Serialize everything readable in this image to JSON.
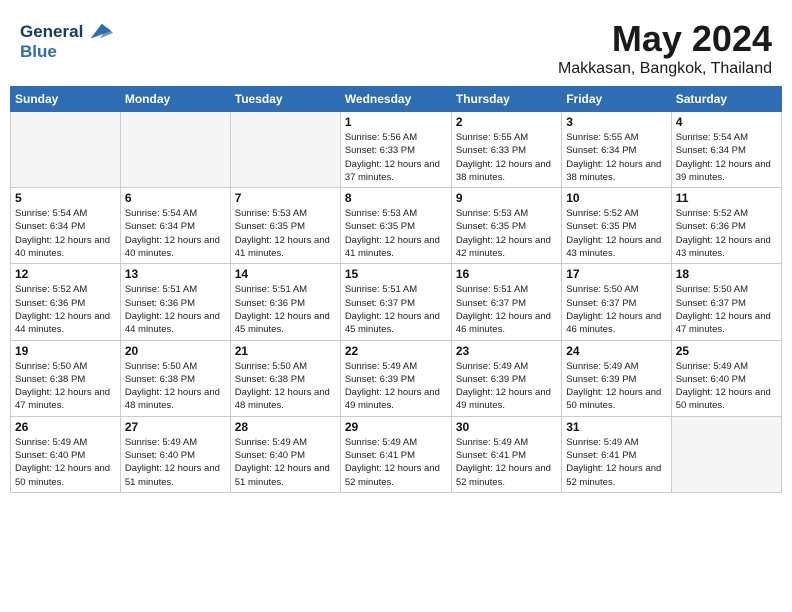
{
  "header": {
    "logo_line1": "General",
    "logo_line2": "Blue",
    "month": "May 2024",
    "location": "Makkasan, Bangkok, Thailand"
  },
  "days_of_week": [
    "Sunday",
    "Monday",
    "Tuesday",
    "Wednesday",
    "Thursday",
    "Friday",
    "Saturday"
  ],
  "weeks": [
    [
      {
        "day": "",
        "sunrise": "",
        "sunset": "",
        "daylight": "",
        "empty": true
      },
      {
        "day": "",
        "sunrise": "",
        "sunset": "",
        "daylight": "",
        "empty": true
      },
      {
        "day": "",
        "sunrise": "",
        "sunset": "",
        "daylight": "",
        "empty": true
      },
      {
        "day": "1",
        "sunrise": "Sunrise: 5:56 AM",
        "sunset": "Sunset: 6:33 PM",
        "daylight": "Daylight: 12 hours and 37 minutes.",
        "empty": false
      },
      {
        "day": "2",
        "sunrise": "Sunrise: 5:55 AM",
        "sunset": "Sunset: 6:33 PM",
        "daylight": "Daylight: 12 hours and 38 minutes.",
        "empty": false
      },
      {
        "day": "3",
        "sunrise": "Sunrise: 5:55 AM",
        "sunset": "Sunset: 6:34 PM",
        "daylight": "Daylight: 12 hours and 38 minutes.",
        "empty": false
      },
      {
        "day": "4",
        "sunrise": "Sunrise: 5:54 AM",
        "sunset": "Sunset: 6:34 PM",
        "daylight": "Daylight: 12 hours and 39 minutes.",
        "empty": false
      }
    ],
    [
      {
        "day": "5",
        "sunrise": "Sunrise: 5:54 AM",
        "sunset": "Sunset: 6:34 PM",
        "daylight": "Daylight: 12 hours and 40 minutes.",
        "empty": false
      },
      {
        "day": "6",
        "sunrise": "Sunrise: 5:54 AM",
        "sunset": "Sunset: 6:34 PM",
        "daylight": "Daylight: 12 hours and 40 minutes.",
        "empty": false
      },
      {
        "day": "7",
        "sunrise": "Sunrise: 5:53 AM",
        "sunset": "Sunset: 6:35 PM",
        "daylight": "Daylight: 12 hours and 41 minutes.",
        "empty": false
      },
      {
        "day": "8",
        "sunrise": "Sunrise: 5:53 AM",
        "sunset": "Sunset: 6:35 PM",
        "daylight": "Daylight: 12 hours and 41 minutes.",
        "empty": false
      },
      {
        "day": "9",
        "sunrise": "Sunrise: 5:53 AM",
        "sunset": "Sunset: 6:35 PM",
        "daylight": "Daylight: 12 hours and 42 minutes.",
        "empty": false
      },
      {
        "day": "10",
        "sunrise": "Sunrise: 5:52 AM",
        "sunset": "Sunset: 6:35 PM",
        "daylight": "Daylight: 12 hours and 43 minutes.",
        "empty": false
      },
      {
        "day": "11",
        "sunrise": "Sunrise: 5:52 AM",
        "sunset": "Sunset: 6:36 PM",
        "daylight": "Daylight: 12 hours and 43 minutes.",
        "empty": false
      }
    ],
    [
      {
        "day": "12",
        "sunrise": "Sunrise: 5:52 AM",
        "sunset": "Sunset: 6:36 PM",
        "daylight": "Daylight: 12 hours and 44 minutes.",
        "empty": false
      },
      {
        "day": "13",
        "sunrise": "Sunrise: 5:51 AM",
        "sunset": "Sunset: 6:36 PM",
        "daylight": "Daylight: 12 hours and 44 minutes.",
        "empty": false
      },
      {
        "day": "14",
        "sunrise": "Sunrise: 5:51 AM",
        "sunset": "Sunset: 6:36 PM",
        "daylight": "Daylight: 12 hours and 45 minutes.",
        "empty": false
      },
      {
        "day": "15",
        "sunrise": "Sunrise: 5:51 AM",
        "sunset": "Sunset: 6:37 PM",
        "daylight": "Daylight: 12 hours and 45 minutes.",
        "empty": false
      },
      {
        "day": "16",
        "sunrise": "Sunrise: 5:51 AM",
        "sunset": "Sunset: 6:37 PM",
        "daylight": "Daylight: 12 hours and 46 minutes.",
        "empty": false
      },
      {
        "day": "17",
        "sunrise": "Sunrise: 5:50 AM",
        "sunset": "Sunset: 6:37 PM",
        "daylight": "Daylight: 12 hours and 46 minutes.",
        "empty": false
      },
      {
        "day": "18",
        "sunrise": "Sunrise: 5:50 AM",
        "sunset": "Sunset: 6:37 PM",
        "daylight": "Daylight: 12 hours and 47 minutes.",
        "empty": false
      }
    ],
    [
      {
        "day": "19",
        "sunrise": "Sunrise: 5:50 AM",
        "sunset": "Sunset: 6:38 PM",
        "daylight": "Daylight: 12 hours and 47 minutes.",
        "empty": false
      },
      {
        "day": "20",
        "sunrise": "Sunrise: 5:50 AM",
        "sunset": "Sunset: 6:38 PM",
        "daylight": "Daylight: 12 hours and 48 minutes.",
        "empty": false
      },
      {
        "day": "21",
        "sunrise": "Sunrise: 5:50 AM",
        "sunset": "Sunset: 6:38 PM",
        "daylight": "Daylight: 12 hours and 48 minutes.",
        "empty": false
      },
      {
        "day": "22",
        "sunrise": "Sunrise: 5:49 AM",
        "sunset": "Sunset: 6:39 PM",
        "daylight": "Daylight: 12 hours and 49 minutes.",
        "empty": false
      },
      {
        "day": "23",
        "sunrise": "Sunrise: 5:49 AM",
        "sunset": "Sunset: 6:39 PM",
        "daylight": "Daylight: 12 hours and 49 minutes.",
        "empty": false
      },
      {
        "day": "24",
        "sunrise": "Sunrise: 5:49 AM",
        "sunset": "Sunset: 6:39 PM",
        "daylight": "Daylight: 12 hours and 50 minutes.",
        "empty": false
      },
      {
        "day": "25",
        "sunrise": "Sunrise: 5:49 AM",
        "sunset": "Sunset: 6:40 PM",
        "daylight": "Daylight: 12 hours and 50 minutes.",
        "empty": false
      }
    ],
    [
      {
        "day": "26",
        "sunrise": "Sunrise: 5:49 AM",
        "sunset": "Sunset: 6:40 PM",
        "daylight": "Daylight: 12 hours and 50 minutes.",
        "empty": false
      },
      {
        "day": "27",
        "sunrise": "Sunrise: 5:49 AM",
        "sunset": "Sunset: 6:40 PM",
        "daylight": "Daylight: 12 hours and 51 minutes.",
        "empty": false
      },
      {
        "day": "28",
        "sunrise": "Sunrise: 5:49 AM",
        "sunset": "Sunset: 6:40 PM",
        "daylight": "Daylight: 12 hours and 51 minutes.",
        "empty": false
      },
      {
        "day": "29",
        "sunrise": "Sunrise: 5:49 AM",
        "sunset": "Sunset: 6:41 PM",
        "daylight": "Daylight: 12 hours and 52 minutes.",
        "empty": false
      },
      {
        "day": "30",
        "sunrise": "Sunrise: 5:49 AM",
        "sunset": "Sunset: 6:41 PM",
        "daylight": "Daylight: 12 hours and 52 minutes.",
        "empty": false
      },
      {
        "day": "31",
        "sunrise": "Sunrise: 5:49 AM",
        "sunset": "Sunset: 6:41 PM",
        "daylight": "Daylight: 12 hours and 52 minutes.",
        "empty": false
      },
      {
        "day": "",
        "sunrise": "",
        "sunset": "",
        "daylight": "",
        "empty": true
      }
    ]
  ]
}
